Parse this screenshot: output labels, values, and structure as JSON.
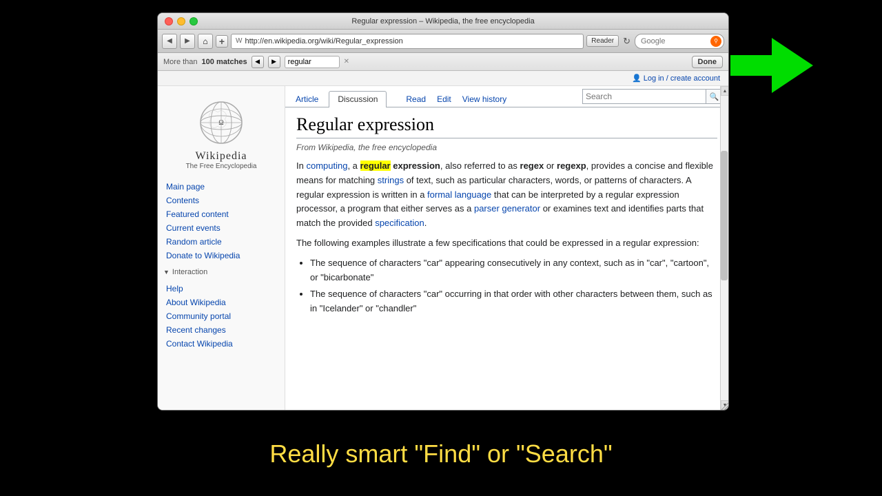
{
  "window": {
    "title": "Regular expression – Wikipedia, the free encyclopedia",
    "address": "http://en.wikipedia.org/wiki/Regular_expression",
    "search_placeholder": "Google",
    "reader_label": "Reader",
    "find_label": "More than",
    "find_bold": "100 matches",
    "find_input_value": "regular",
    "find_done_label": "Done"
  },
  "login": {
    "text": "Log in / create account",
    "icon": "👤"
  },
  "tabs": {
    "article_label": "Article",
    "discussion_label": "Discussion",
    "read_label": "Read",
    "edit_label": "Edit",
    "view_history_label": "View history",
    "search_placeholder": "Search"
  },
  "wiki": {
    "title": "Wikipedia",
    "subtitle": "The Free Encyclopedia"
  },
  "sidebar": {
    "nav_items": [
      {
        "label": "Main page",
        "id": "main-page"
      },
      {
        "label": "Contents",
        "id": "contents"
      },
      {
        "label": "Featured content",
        "id": "featured-content"
      },
      {
        "label": "Current events",
        "id": "current-events"
      },
      {
        "label": "Random article",
        "id": "random-article"
      },
      {
        "label": "Donate to Wikipedia",
        "id": "donate"
      }
    ],
    "interaction_header": "Interaction",
    "interaction_items": [
      {
        "label": "Help",
        "id": "help"
      },
      {
        "label": "About Wikipedia",
        "id": "about"
      },
      {
        "label": "Community portal",
        "id": "community-portal"
      },
      {
        "label": "Recent changes",
        "id": "recent-changes"
      },
      {
        "label": "Contact Wikipedia",
        "id": "contact"
      }
    ]
  },
  "article": {
    "title": "Regular expression",
    "subtitle": "From Wikipedia, the free encyclopedia",
    "paragraphs": [
      {
        "id": "p1",
        "parts": [
          {
            "text": "In ",
            "type": "normal"
          },
          {
            "text": "computing",
            "type": "link"
          },
          {
            "text": ", a ",
            "type": "normal"
          },
          {
            "text": "regular",
            "type": "highlight-bold"
          },
          {
            "text": " ",
            "type": "normal"
          },
          {
            "text": "expression",
            "type": "bold"
          },
          {
            "text": ", also referred to as ",
            "type": "normal"
          },
          {
            "text": "regex",
            "type": "bold"
          },
          {
            "text": " or ",
            "type": "normal"
          },
          {
            "text": "regexp",
            "type": "bold"
          },
          {
            "text": ", provides a concise and flexible means for matching ",
            "type": "normal"
          },
          {
            "text": "strings",
            "type": "link"
          },
          {
            "text": " of text, such as particular characters, words, or patterns of characters. A regular expression is written in a ",
            "type": "normal"
          },
          {
            "text": "formal language",
            "type": "link"
          },
          {
            "text": " that can be interpreted by a regular expression processor, a program that either serves as a ",
            "type": "normal"
          },
          {
            "text": "parser generator",
            "type": "link"
          },
          {
            "text": " or examines text and identifies parts that match the provided ",
            "type": "normal"
          },
          {
            "text": "specification",
            "type": "link"
          },
          {
            "text": ".",
            "type": "normal"
          }
        ]
      },
      {
        "id": "p2",
        "text": "The following examples illustrate a few specifications that could be expressed in a regular expression:"
      }
    ],
    "list_items": [
      "The sequence of characters \"car\" appearing consecutively in any context, such as in \"car\", \"cartoon\", or \"bicarbonate\"",
      "The sequence of characters \"car\" occurring in that order with other characters between them, such as in \"Icelander\" or \"chandler\""
    ]
  },
  "bottom_caption": "Really smart \"Find\" or \"Search\"",
  "colors": {
    "link": "#0645ad",
    "highlight": "#ffff00",
    "green_arrow": "#00cc00",
    "bottom_text": "#ffdd44"
  }
}
